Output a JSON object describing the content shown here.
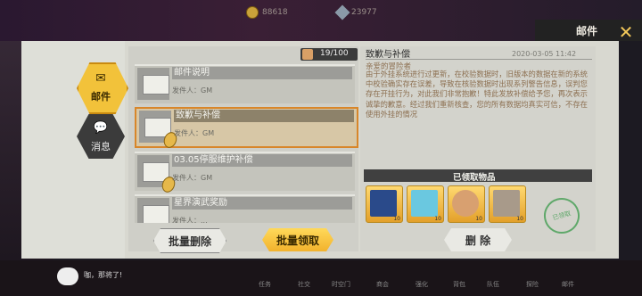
{
  "header": {
    "title": "邮件",
    "currency1": "88618",
    "currency2": "23977"
  },
  "tabs": [
    {
      "label": "邮件"
    },
    {
      "label": "消息"
    }
  ],
  "mail_count": "19/100",
  "mail_list": [
    {
      "title": "邮件说明",
      "sender": "发件人：GM"
    },
    {
      "title": "致歉与补偿",
      "sender": "发件人：GM"
    },
    {
      "title": "03.05停服维护补偿",
      "sender": "发件人：GM"
    },
    {
      "title": "星界演武奖励",
      "sender": "发件人：..."
    }
  ],
  "buttons": {
    "batch_delete": "批量删除",
    "batch_claim": "批量领取",
    "delete": "删 除"
  },
  "detail": {
    "title": "致歉与补偿",
    "date": "2020-03-05 11:42",
    "greeting": "亲爱的冒险者",
    "body": "由于外挂系统进行过更新，在校验数据时，旧版本的数据在新的系统中校验确实存在误差，导致在核验数据时出现系列警告信息，误判您存在开挂行为，对此我们非常抱歉！特此发放补偿给予您，再次表示诚挚的歉意。经过我们重新核查，您的所有数据均真实可信，不存在使用外挂的情况"
  },
  "attachments": {
    "header": "已领取物品",
    "items": [
      {
        "qty": "10"
      },
      {
        "qty": "10"
      },
      {
        "qty": "10"
      },
      {
        "qty": "10"
      }
    ],
    "stamp": "已领取"
  },
  "bottom": {
    "chat": "咖，那将了!",
    "nav": [
      "任务",
      "社交",
      "时空门",
      "商会",
      "强化",
      "背包",
      "队伍",
      "探险",
      "邮件"
    ]
  }
}
